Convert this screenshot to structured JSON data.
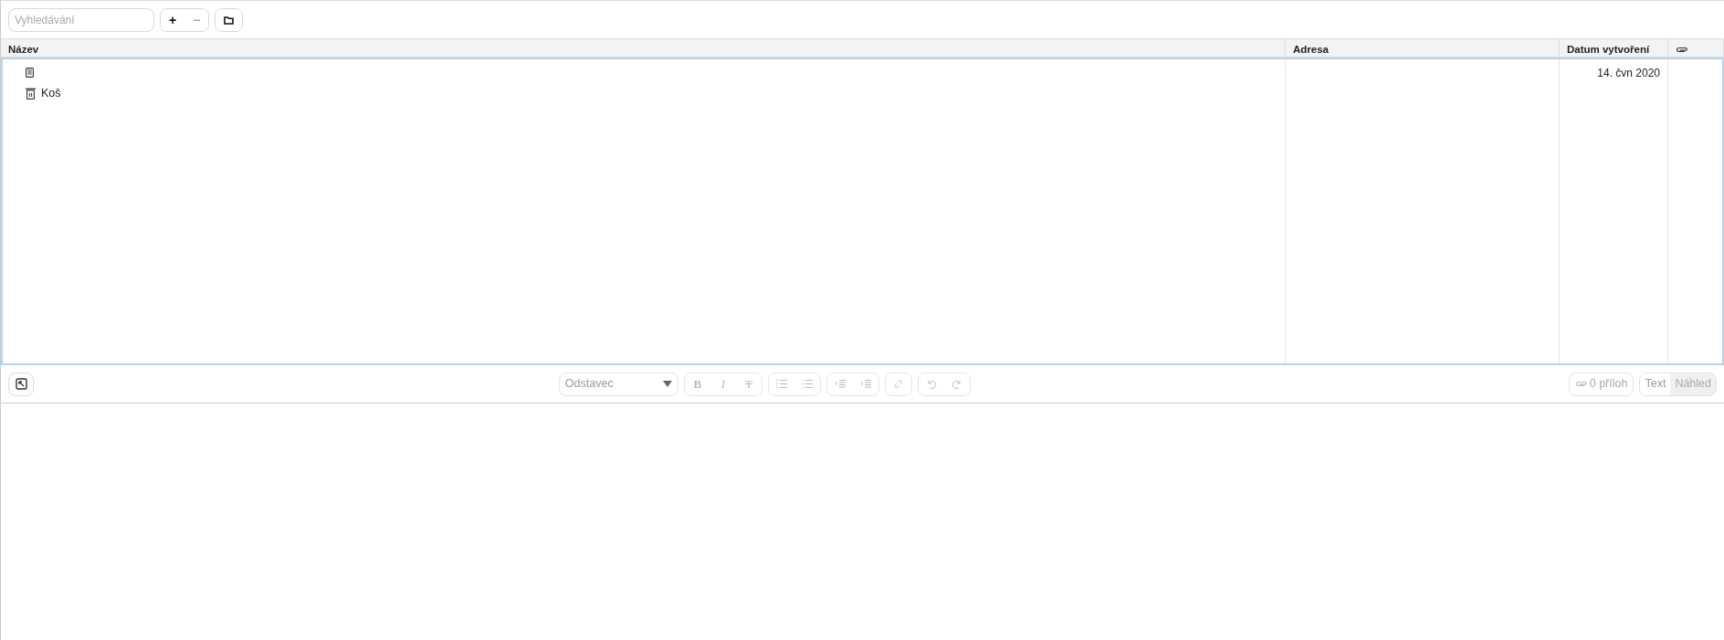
{
  "search": {
    "placeholder": "Vyhledávání"
  },
  "toolbar_buttons": [
    {
      "kind": "plus",
      "label": "+"
    },
    {
      "kind": "minus",
      "label": "−"
    }
  ],
  "table": {
    "columns": [
      "Název",
      "Adresa",
      "Datum vytvoření"
    ],
    "rows": [
      {
        "kind": "note",
        "title": "",
        "address": "",
        "created": "14. čvn 2020"
      },
      {
        "kind": "trash",
        "title": "Koš",
        "address": "",
        "created": ""
      }
    ]
  },
  "editor": {
    "paragraph_style": "Odstavec",
    "disabled": true,
    "format_buttons": [
      {
        "kind": "bold",
        "label": "B"
      },
      {
        "kind": "italic",
        "label": "I"
      },
      {
        "kind": "strike",
        "label": "T"
      }
    ],
    "attachments": "0 příloh",
    "view_tabs": [
      {
        "label": "Text",
        "selected": false
      },
      {
        "label": "Náhled",
        "selected": true
      }
    ]
  }
}
